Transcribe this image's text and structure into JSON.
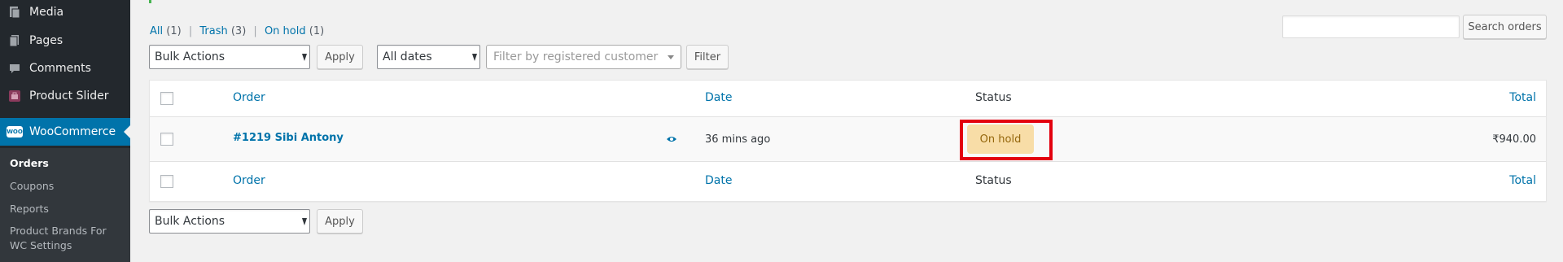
{
  "sidebar": {
    "items": [
      {
        "label": "Media",
        "icon": "media-icon"
      },
      {
        "label": "Pages",
        "icon": "pages-icon"
      },
      {
        "label": "Comments",
        "icon": "comments-icon"
      },
      {
        "label": "Product Slider",
        "icon": "product-slider-icon"
      },
      {
        "label": "WooCommerce",
        "icon": "woocommerce-icon",
        "icon_text": "WOO"
      }
    ],
    "submenu": [
      "Orders",
      "Coupons",
      "Reports",
      "Product Brands For",
      "WC Settings"
    ]
  },
  "filters": {
    "views": [
      {
        "label": "All",
        "count": "(1)"
      },
      {
        "label": "Trash",
        "count": "(3)"
      },
      {
        "label": "On hold",
        "count": "(1)"
      }
    ],
    "separator": "|",
    "bulk_actions": "Bulk Actions",
    "apply": "Apply",
    "dates": "All dates",
    "customer_placeholder": "Filter by registered customer",
    "filter_button": "Filter",
    "search_button": "Search orders"
  },
  "table": {
    "headers": {
      "order": "Order",
      "date": "Date",
      "status": "Status",
      "total": "Total"
    },
    "rows": [
      {
        "order": "#1219 Sibi Antony",
        "date": "36 mins ago",
        "status": "On hold",
        "total": "₹940.00"
      }
    ]
  },
  "colors": {
    "accent": "#0073aa",
    "sidebar_bg": "#23282d",
    "status_on_hold_bg": "#f8dda7",
    "highlight": "#e3000f"
  }
}
